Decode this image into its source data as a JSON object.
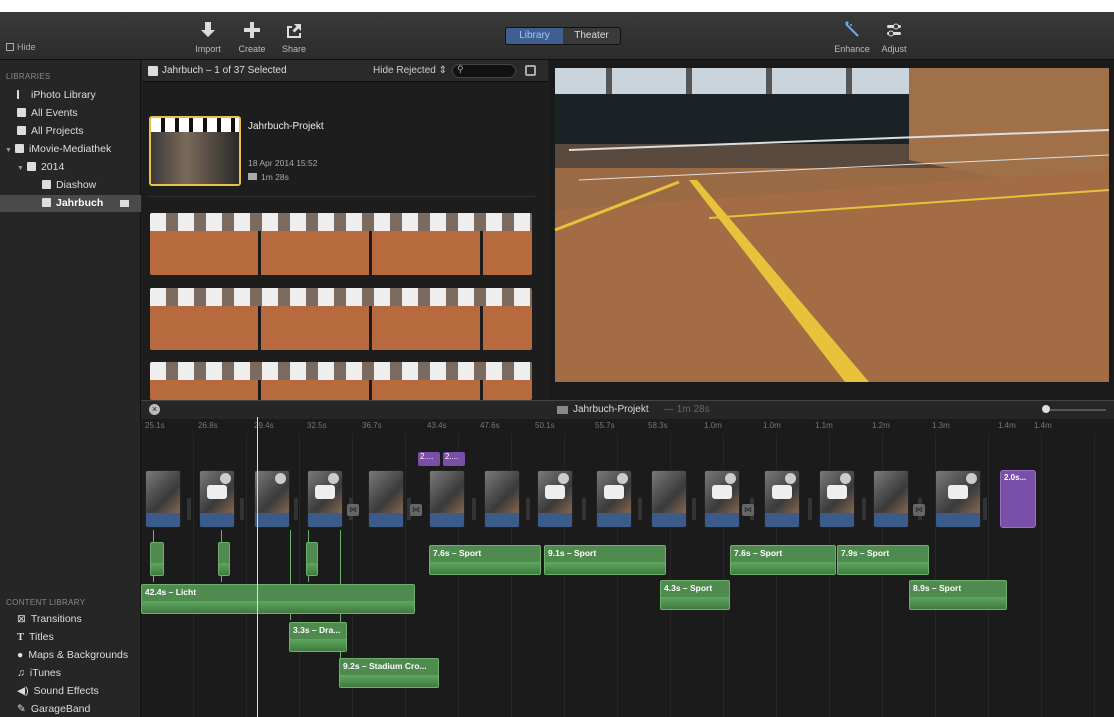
{
  "toolbar": {
    "hide_label": "Hide",
    "import_label": "Import",
    "create_label": "Create",
    "share_label": "Share",
    "library_tab": "Library",
    "theater_tab": "Theater",
    "enhance_label": "Enhance",
    "adjust_label": "Adjust"
  },
  "sidebar": {
    "libraries_header": "LIBRARIES",
    "items": [
      {
        "label": "iPhoto Library"
      },
      {
        "label": "All Events"
      },
      {
        "label": "All Projects"
      },
      {
        "label": "iMovie-Mediathek"
      },
      {
        "label": "2014"
      },
      {
        "label": "Diashow"
      },
      {
        "label": "Jahrbuch"
      }
    ],
    "content_header": "CONTENT LIBRARY",
    "content_items": [
      {
        "label": "Transitions"
      },
      {
        "label": "Titles"
      },
      {
        "label": "Maps & Backgrounds"
      },
      {
        "label": "iTunes"
      },
      {
        "label": "Sound Effects"
      },
      {
        "label": "GarageBand"
      }
    ]
  },
  "browser": {
    "title": "Jahrbuch – 1 of 37 Selected",
    "filter": "Hide Rejected",
    "project_name": "Jahrbuch-Projekt",
    "project_date": "18 Apr 2014 15:52",
    "project_duration": "1m 28s"
  },
  "timeline": {
    "project_title": "Jahrbuch-Projekt",
    "project_duration": "1m 28s",
    "ruler": [
      "25.1s",
      "26.8s",
      "29.4s",
      "32.5s",
      "36.7s",
      "43.4s",
      "47.6s",
      "50.1s",
      "55.7s",
      "58.3s",
      "1.0m",
      "1.0m",
      "1.1m",
      "1.2m",
      "1.3m",
      "1.4m",
      "1.4m"
    ],
    "title_badges": [
      "2....",
      "2...."
    ],
    "purple_clip": "2.0s...",
    "audio": [
      {
        "label": "7.6s – Sport"
      },
      {
        "label": "9.1s – Sport"
      },
      {
        "label": "7.6s – Sport"
      },
      {
        "label": "7.9s – Sport"
      },
      {
        "label": "4.3s – Sport"
      },
      {
        "label": "8.9s – Sport"
      },
      {
        "label": "42.4s – Licht"
      },
      {
        "label": "3.3s – Dra..."
      },
      {
        "label": "9.2s – Stadium Cro..."
      }
    ]
  },
  "colors": {
    "accent": "#3f5f8f",
    "audio_green": "#4f8a4f",
    "title_purple": "#7a4fa8"
  }
}
